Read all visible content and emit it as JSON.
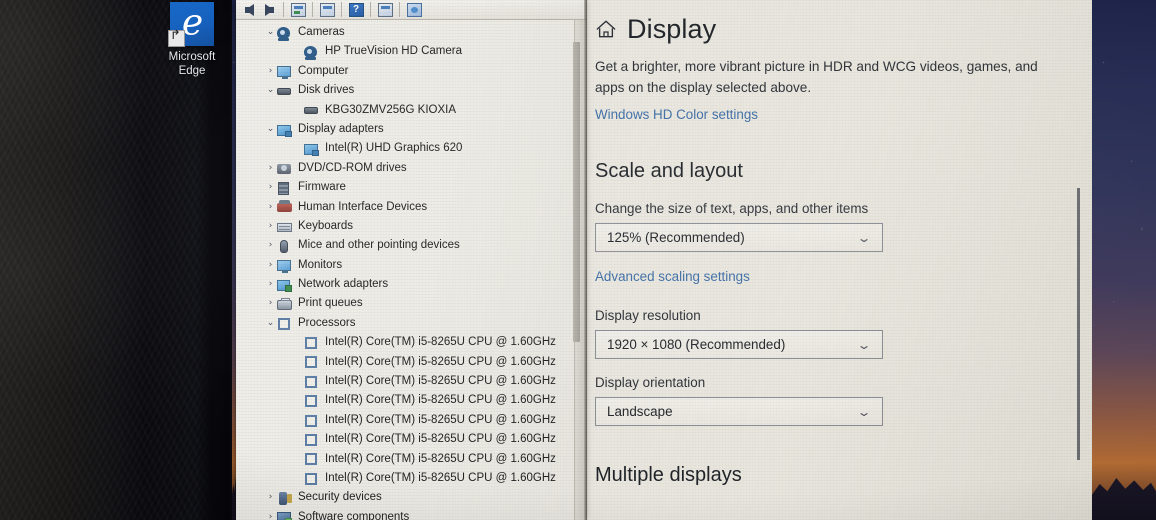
{
  "desktop": {
    "icons": [
      {
        "name": "Microsoft Edge",
        "label_line1": "Microsoft",
        "label_line2": "Edge",
        "glyph": "e",
        "icon": "edge-icon",
        "tile_color": "#1560bd"
      }
    ]
  },
  "device_manager": {
    "window_name": "Device Manager",
    "toolbar": {
      "buttons": [
        {
          "name": "back",
          "icon": "arrow-back-icon"
        },
        {
          "name": "forward",
          "icon": "arrow-forward-icon"
        },
        {
          "name": "properties",
          "icon": "properties-icon"
        },
        {
          "name": "update-driver",
          "icon": "update-driver-icon"
        },
        {
          "name": "help",
          "icon": "help-icon",
          "glyph": "?"
        },
        {
          "name": "disable-device",
          "icon": "disable-device-icon"
        },
        {
          "name": "scan-for-hardware-changes",
          "icon": "scan-hardware-icon"
        }
      ]
    },
    "tree": [
      {
        "label": "Cameras",
        "icon": "camera-icon",
        "state": "expanded",
        "depth": 0
      },
      {
        "label": "HP TrueVision HD Camera",
        "icon": "camera-icon",
        "state": "leaf",
        "depth": 1
      },
      {
        "label": "Computer",
        "icon": "monitor-icon",
        "state": "collapsed",
        "depth": 0
      },
      {
        "label": "Disk drives",
        "icon": "disk-icon",
        "state": "expanded",
        "depth": 0
      },
      {
        "label": "KBG30ZMV256G KIOXIA",
        "icon": "disk-icon",
        "state": "leaf",
        "depth": 1
      },
      {
        "label": "Display adapters",
        "icon": "display-adapter-icon",
        "state": "expanded",
        "depth": 0
      },
      {
        "label": "Intel(R) UHD Graphics 620",
        "icon": "display-adapter-icon",
        "state": "leaf",
        "depth": 1
      },
      {
        "label": "DVD/CD-ROM drives",
        "icon": "dvd-icon",
        "state": "collapsed",
        "depth": 0
      },
      {
        "label": "Firmware",
        "icon": "firmware-icon",
        "state": "collapsed",
        "depth": 0
      },
      {
        "label": "Human Interface Devices",
        "icon": "hid-icon",
        "state": "collapsed",
        "depth": 0
      },
      {
        "label": "Keyboards",
        "icon": "keyboard-icon",
        "state": "collapsed",
        "depth": 0
      },
      {
        "label": "Mice and other pointing devices",
        "icon": "mouse-icon",
        "state": "collapsed",
        "depth": 0
      },
      {
        "label": "Monitors",
        "icon": "monitor-icon",
        "state": "collapsed",
        "depth": 0
      },
      {
        "label": "Network adapters",
        "icon": "network-icon",
        "state": "collapsed",
        "depth": 0
      },
      {
        "label": "Print queues",
        "icon": "printer-icon",
        "state": "collapsed",
        "depth": 0
      },
      {
        "label": "Processors",
        "icon": "cpu-icon",
        "state": "expanded",
        "depth": 0
      },
      {
        "label": "Intel(R) Core(TM) i5-8265U CPU @ 1.60GHz",
        "icon": "cpu-icon",
        "state": "leaf",
        "depth": 1
      },
      {
        "label": "Intel(R) Core(TM) i5-8265U CPU @ 1.60GHz",
        "icon": "cpu-icon",
        "state": "leaf",
        "depth": 1
      },
      {
        "label": "Intel(R) Core(TM) i5-8265U CPU @ 1.60GHz",
        "icon": "cpu-icon",
        "state": "leaf",
        "depth": 1
      },
      {
        "label": "Intel(R) Core(TM) i5-8265U CPU @ 1.60GHz",
        "icon": "cpu-icon",
        "state": "leaf",
        "depth": 1
      },
      {
        "label": "Intel(R) Core(TM) i5-8265U CPU @ 1.60GHz",
        "icon": "cpu-icon",
        "state": "leaf",
        "depth": 1
      },
      {
        "label": "Intel(R) Core(TM) i5-8265U CPU @ 1.60GHz",
        "icon": "cpu-icon",
        "state": "leaf",
        "depth": 1
      },
      {
        "label": "Intel(R) Core(TM) i5-8265U CPU @ 1.60GHz",
        "icon": "cpu-icon",
        "state": "leaf",
        "depth": 1
      },
      {
        "label": "Intel(R) Core(TM) i5-8265U CPU @ 1.60GHz",
        "icon": "cpu-icon",
        "state": "leaf",
        "depth": 1
      },
      {
        "label": "Security devices",
        "icon": "security-icon",
        "state": "collapsed",
        "depth": 0
      },
      {
        "label": "Software components",
        "icon": "software-icon",
        "state": "collapsed",
        "depth": 0
      }
    ],
    "chevron_expanded": "⌄",
    "chevron_collapsed": "›"
  },
  "settings": {
    "page_title": "Display",
    "home_icon": "home-icon",
    "hdr_description": "Get a brighter, more vibrant picture in HDR and WCG videos, games, and apps on the display selected above.",
    "hdr_link": "Windows HD Color settings",
    "scale_section_title": "Scale and layout",
    "scale_label": "Change the size of text, apps, and other items",
    "scale_value": "125% (Recommended)",
    "advanced_scaling_link": "Advanced scaling settings",
    "resolution_label": "Display resolution",
    "resolution_value": "1920 × 1080 (Recommended)",
    "orientation_label": "Display orientation",
    "orientation_value": "Landscape",
    "multiple_displays_title": "Multiple displays",
    "link_color": "#3f6fa8",
    "chevron_down": "⌄"
  }
}
